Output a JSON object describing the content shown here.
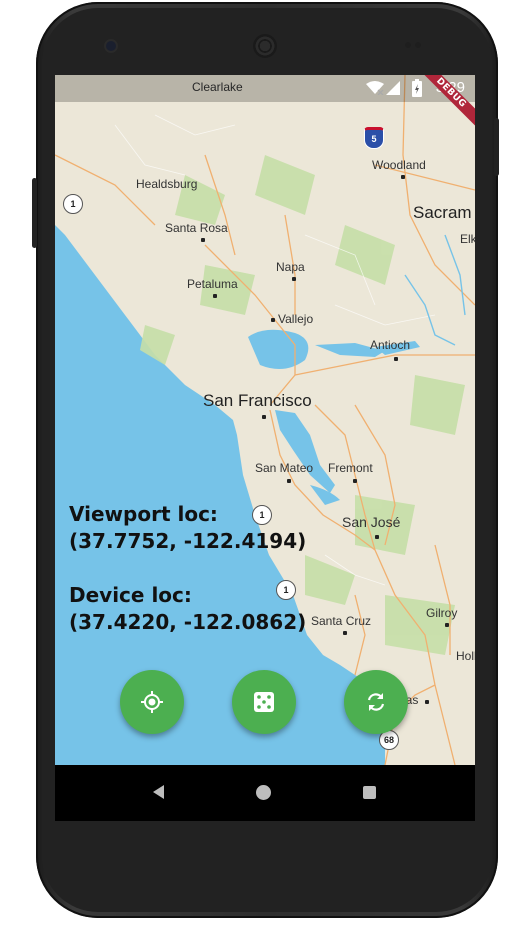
{
  "status_bar": {
    "time": "3:29",
    "debug_banner": "DEBUG"
  },
  "map": {
    "places": {
      "clearlake": "Clearlake",
      "healdsburg": "Healdsburg",
      "santa_rosa": "Santa Rosa",
      "napa": "Napa",
      "petaluma": "Petaluma",
      "vallejo": "Vallejo",
      "woodland": "Woodland",
      "sacramento": "Sacram",
      "elk": "Elk",
      "antioch": "Antioch",
      "san_francisco": "San Francisco",
      "san_mateo": "San Mateo",
      "fremont": "Fremont",
      "san_jose": "San José",
      "gilroy": "Gilroy",
      "santa_cruz": "Santa Cruz",
      "holl": "Holl",
      "salinas": "Salinas"
    },
    "shields": {
      "hwy1_a": "1",
      "hwy1_b": "1",
      "hwy1_c": "1",
      "i5": "5",
      "hwy68": "68"
    }
  },
  "info": {
    "viewport_label": "Viewport loc:",
    "viewport_value": "(37.7752, -122.4194)",
    "device_label": "Device loc:",
    "device_value": "(37.4220, -122.0862)"
  },
  "fabs": [
    {
      "icon": "my-location-icon"
    },
    {
      "icon": "dice-icon"
    },
    {
      "icon": "refresh-icon"
    }
  ],
  "colors": {
    "fab": "#4caf50",
    "water": "#76c3e8",
    "land": "#eee9dc",
    "debug": "#b0263a"
  }
}
